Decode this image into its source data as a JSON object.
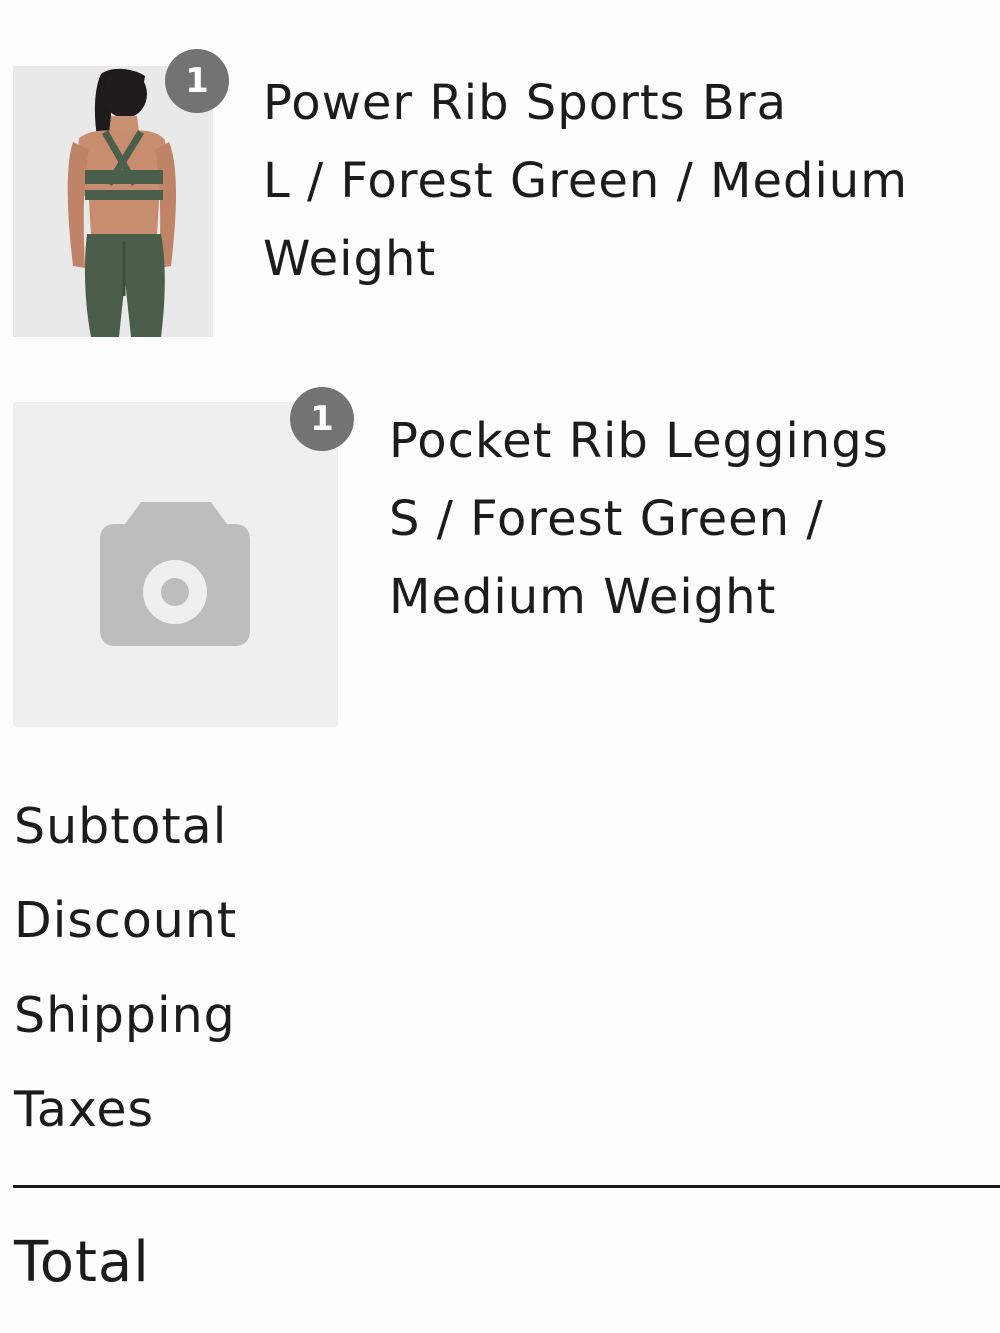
{
  "line_items": [
    {
      "quantity": "1",
      "title": "Power Rib Sports Bra",
      "variant_line_1": "L / Forest Green / Medium",
      "variant_line_2": "Weight",
      "image_icon": "product-photo"
    },
    {
      "quantity": "1",
      "title": "Pocket Rib Leggings",
      "variant_line_1": "S / Forest Green /",
      "variant_line_2": "Medium Weight",
      "image_icon": "camera-icon"
    }
  ],
  "summary": {
    "subtotal_label": "Subtotal",
    "discount_label": "Discount",
    "shipping_label": "Shipping",
    "taxes_label": "Taxes",
    "total_label": "Total"
  },
  "colors": {
    "badge": "#737373",
    "placeholder_bg": "#efefef",
    "camera_icon": "#bdbdbd",
    "text": "#1c1c1c",
    "product_green": "#4b5e4c"
  }
}
